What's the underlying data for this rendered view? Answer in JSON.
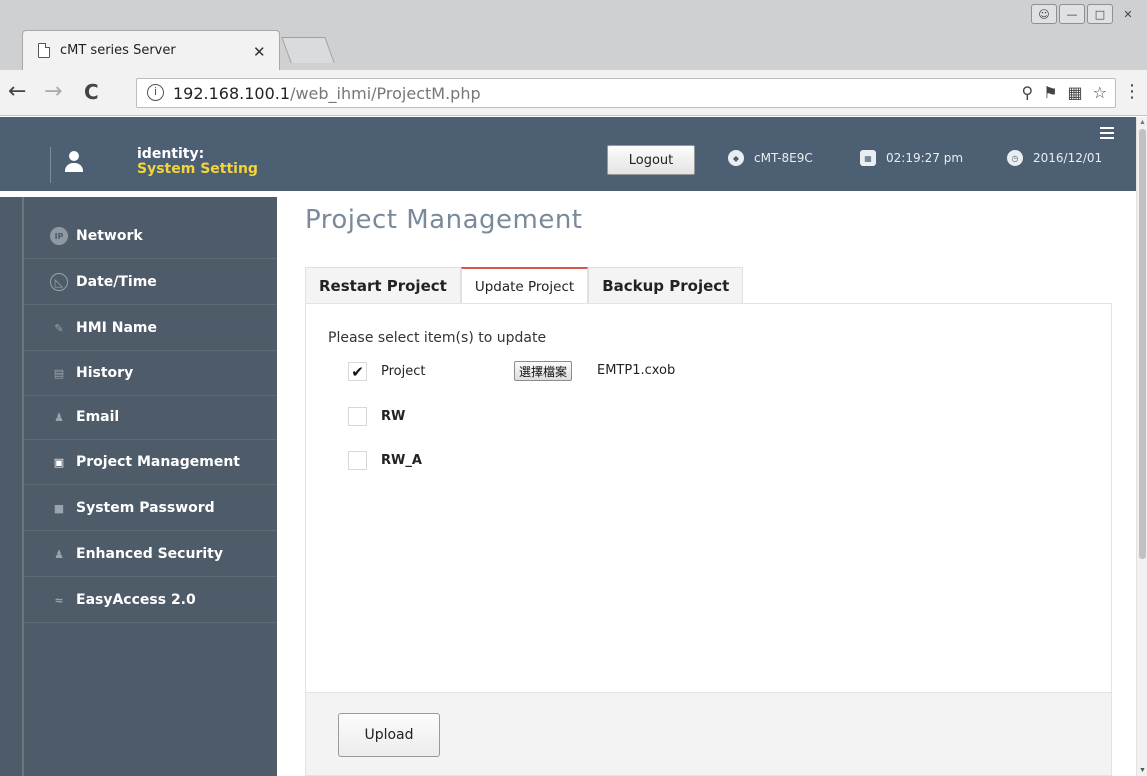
{
  "browser": {
    "tab_title": "cMT series Server",
    "tab_close": "✕",
    "url_host": "192.168.100.1",
    "url_path": "/web_ihmi/ProjectM.php",
    "back": "←",
    "forward": "→",
    "reload": "C",
    "info": "i",
    "omni_icons": [
      "zoom-icon",
      "key-icon",
      "translate-icon",
      "star-icon"
    ],
    "menu": "⋮"
  },
  "header": {
    "identity_label": "identity:",
    "identity_role": "System Setting",
    "logout_label": "Logout",
    "device_name": "cMT-8E9C",
    "time": "02:19:27 pm",
    "date": "2016/12/01",
    "accent_color": "#f3d43b"
  },
  "sidebar": {
    "items": [
      {
        "label": "Network",
        "icon": "ip-icon"
      },
      {
        "label": "Date/Time",
        "icon": "clock-icon"
      },
      {
        "label": "HMI Name",
        "icon": "pencil-icon"
      },
      {
        "label": "History",
        "icon": "file-icon"
      },
      {
        "label": "Email",
        "icon": "users-icon"
      },
      {
        "label": "Project Management",
        "icon": "project-icon"
      },
      {
        "label": "System Password",
        "icon": "lock-icon"
      },
      {
        "label": "Enhanced Security",
        "icon": "security-users-icon"
      },
      {
        "label": "EasyAccess 2.0",
        "icon": "easyaccess-icon"
      }
    ]
  },
  "main": {
    "title": "Project Management",
    "tabs": [
      {
        "label": "Restart Project"
      },
      {
        "label": "Update Project"
      },
      {
        "label": "Backup Project"
      }
    ],
    "instruction": "Please select item(s) to update",
    "items": [
      {
        "label": "Project",
        "checked": true,
        "mark": "✔"
      },
      {
        "label": "RW",
        "checked": false,
        "mark": ""
      },
      {
        "label": "RW_A",
        "checked": false,
        "mark": ""
      }
    ],
    "file_button": "選擇檔案",
    "file_name": "EMTP1.cxob",
    "upload_label": "Upload"
  }
}
